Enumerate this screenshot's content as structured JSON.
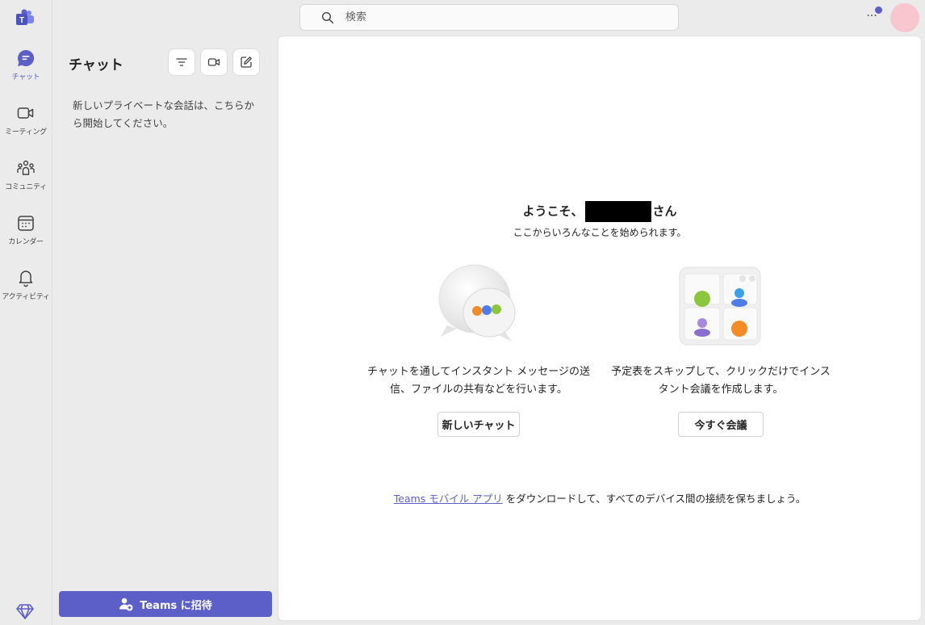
{
  "rail": {
    "items": [
      {
        "label": "チャット",
        "icon": "chat-icon",
        "active": true
      },
      {
        "label": "ミーティング",
        "icon": "video-camera-icon",
        "active": false
      },
      {
        "label": "コミュニティ",
        "icon": "community-icon",
        "active": false
      },
      {
        "label": "カレンダー",
        "icon": "calendar-icon",
        "active": false
      },
      {
        "label": "アクティビティ",
        "icon": "bell-icon",
        "active": false
      }
    ]
  },
  "search": {
    "placeholder": "検索"
  },
  "header": {
    "more": "···"
  },
  "chat_pane": {
    "title": "チャット",
    "empty_message": "新しいプライベートな会話は、こちらから開始してください。",
    "invite_label": "Teams に招待"
  },
  "main": {
    "welcome_prefix": "ようこそ、",
    "welcome_suffix": "さん",
    "subtitle": "ここからいろんなことを始められます。",
    "chat_card": {
      "description": "チャットを通してインスタント メッセージの送信、ファイルの共有などを行います。",
      "button": "新しいチャット"
    },
    "meet_card": {
      "description": "予定表をスキップして、クリックだけでインスタント会議を作成します。",
      "button": "今すぐ会議"
    },
    "footer_link": "Teams モバイル アプリ",
    "footer_text": " をダウンロードして、すべてのデバイス間の接続を保ちましょう。"
  },
  "colors": {
    "accent": "#5b5fc7",
    "background": "#ebebeb",
    "card": "#ffffff"
  }
}
